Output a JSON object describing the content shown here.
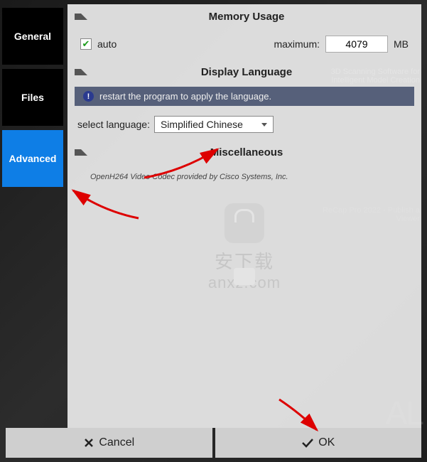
{
  "sidebar": {
    "tabs": [
      {
        "label": "General",
        "active": false
      },
      {
        "label": "Files",
        "active": false
      },
      {
        "label": "Advanced",
        "active": true
      }
    ]
  },
  "sections": {
    "memory": {
      "title": "Memory Usage",
      "auto_label": "auto",
      "auto_checked": true,
      "max_label": "maximum:",
      "max_value": "4079",
      "unit": "MB"
    },
    "language": {
      "title": "Display Language",
      "info_text": "restart the program to apply the language.",
      "select_label": "select language:",
      "selected": "Simplified Chinese"
    },
    "misc": {
      "title": "Miscellaneous",
      "codec_text": "OpenH264 Video Codec provided by Cisco Systems, Inc."
    }
  },
  "footer": {
    "cancel": "Cancel",
    "ok": "OK"
  },
  "watermark": {
    "cn": "安下载",
    "url": "anxz.com"
  },
  "bg": {
    "t1a": "3D Scanning Software for",
    "t1b": "Intelligent Model Creation",
    "t2a": "ReCap Pro 2022 - Publish a",
    "t2b": "Viewer"
  }
}
